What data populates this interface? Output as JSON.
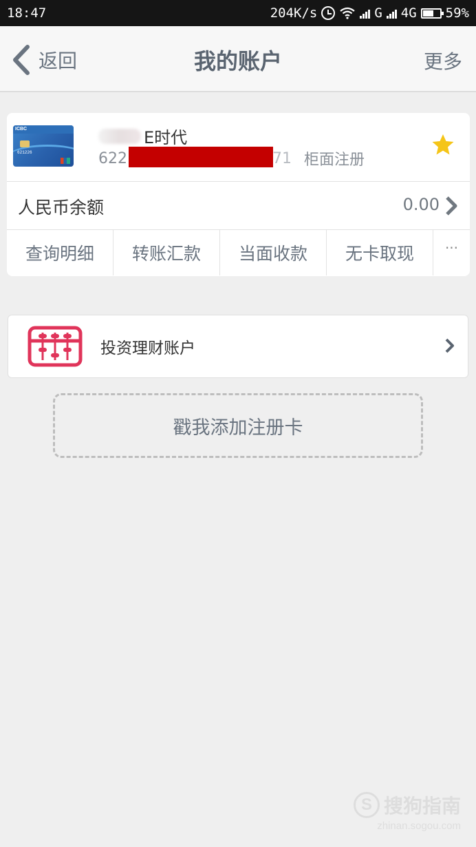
{
  "status_bar": {
    "time": "18:47",
    "net_speed": "204K/s",
    "network_g": "G",
    "network_4g": "4G",
    "battery": "59%"
  },
  "nav": {
    "back_label": "返回",
    "title": "我的账户",
    "more_label": "更多"
  },
  "account": {
    "name_suffix": "E时代",
    "card_number_prefix": "622",
    "card_number_suffix": "71",
    "register_type": "柜面注册",
    "card_logo_text": "ICBC",
    "card_number_print": "621226",
    "favorite": true,
    "balance_label": "人民币余额",
    "balance_value": "0.00",
    "actions": [
      "查询明细",
      "转账汇款",
      "当面收款",
      "无卡取现"
    ],
    "more_actions": "···"
  },
  "invest": {
    "label": "投资理财账户",
    "icon": "abacus-icon",
    "icon_color": "#e0345a"
  },
  "add_card": {
    "label": "戳我添加注册卡"
  },
  "watermark": {
    "logo": "S",
    "text": "搜狗指南",
    "url": "zhinan.sogou.com"
  },
  "colors": {
    "nav_text": "#6a7480",
    "redaction": "#c40000",
    "star": "#f5c518",
    "background": "#efefef"
  }
}
